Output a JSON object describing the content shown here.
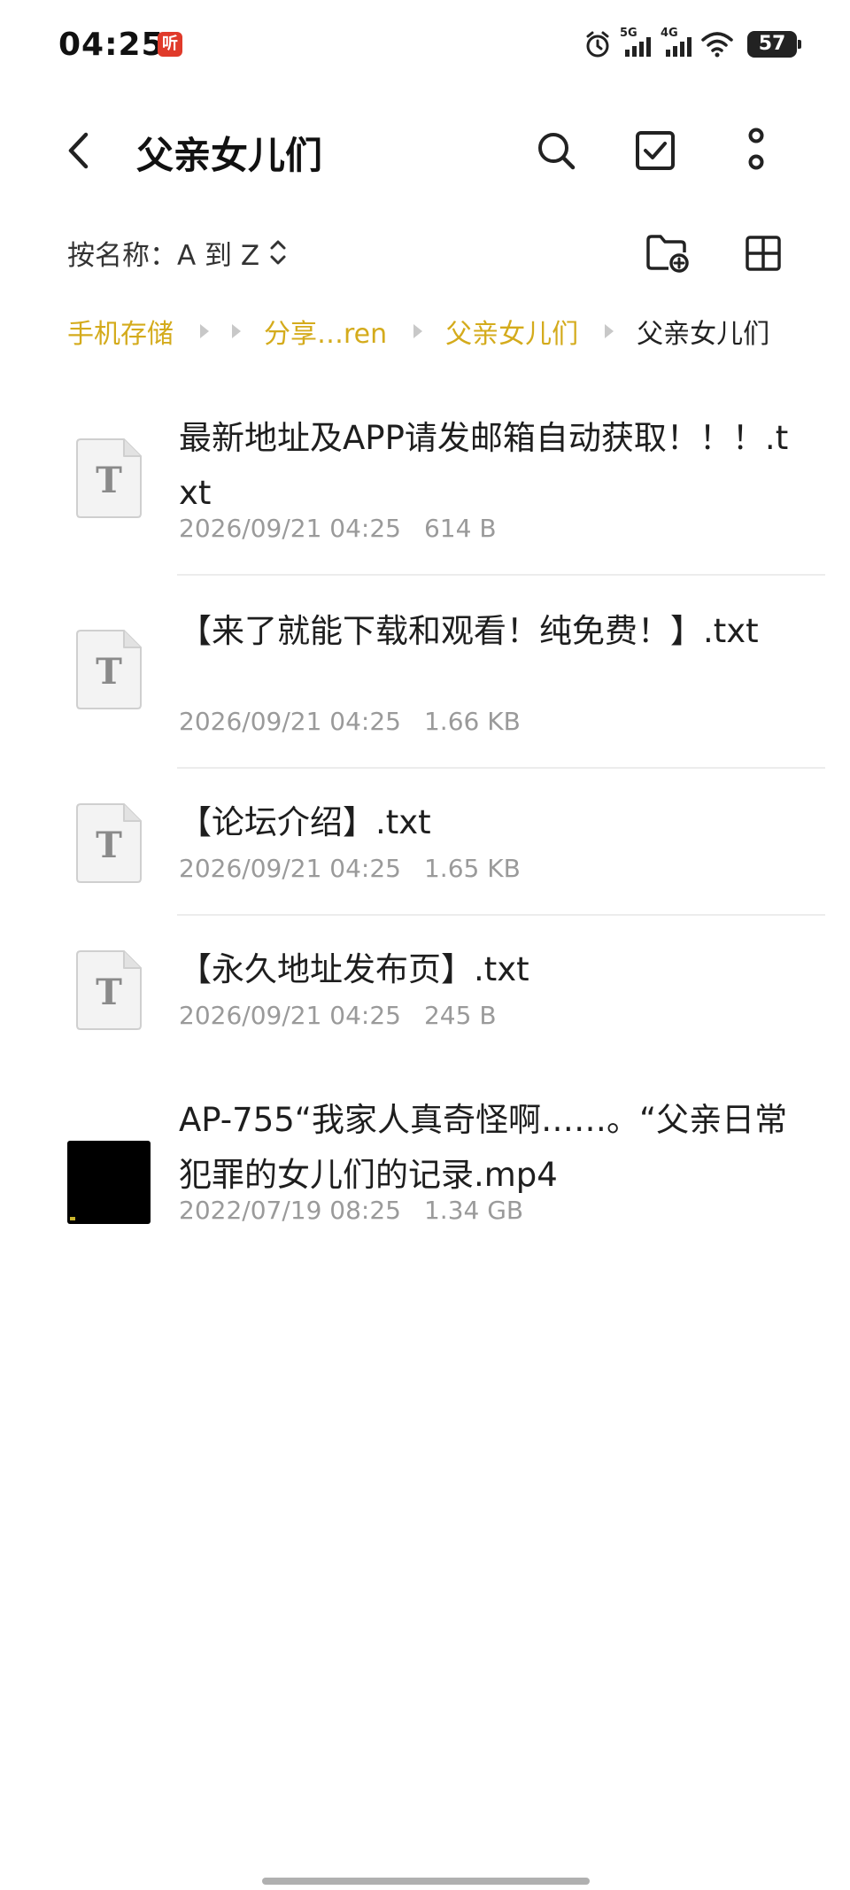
{
  "status_bar": {
    "time": "04:25",
    "app_badge": "听",
    "network_1": "5G",
    "network_2": "4G",
    "battery": "57"
  },
  "app_bar": {
    "title": "父亲女儿们",
    "icons": [
      "back-arrow-icon",
      "search-icon",
      "checkbox-select-icon",
      "more-vertical-icon"
    ]
  },
  "sort": {
    "label": "按名称：A 到 Z",
    "icons": [
      "sort-updown-icon",
      "new-folder-icon",
      "grid-view-icon"
    ]
  },
  "breadcrumb": {
    "items": [
      "手机存储",
      "分享…ren",
      "父亲女儿们",
      "父亲女儿们"
    ]
  },
  "files": [
    {
      "type": "txt",
      "icon_letter": "T",
      "name": "最新地址及APP请发邮箱自动获取！！！.txt",
      "date": "2026/09/21 04:25",
      "size": "614 B"
    },
    {
      "type": "txt",
      "icon_letter": "T",
      "name": "【来了就能下载和观看！纯免费！】.txt",
      "date": "2026/09/21 04:25",
      "size": "1.66 KB"
    },
    {
      "type": "txt",
      "icon_letter": "T",
      "name": "【论坛介绍】.txt",
      "date": "2026/09/21 04:25",
      "size": "1.65 KB"
    },
    {
      "type": "txt",
      "icon_letter": "T",
      "name": "【永久地址发布页】.txt",
      "date": "2026/09/21 04:25",
      "size": "245 B"
    },
    {
      "type": "video",
      "name": "AP-755“我家人真奇怪啊……。“父亲日常犯罪的女儿们的记录.mp4",
      "date": "2022/07/19 08:25",
      "size": "1.34 GB"
    }
  ],
  "colors": {
    "accent": "#d4ab1c",
    "text_primary": "#1e1e1e",
    "text_secondary": "#9a9a9a",
    "divider": "#ececec"
  }
}
